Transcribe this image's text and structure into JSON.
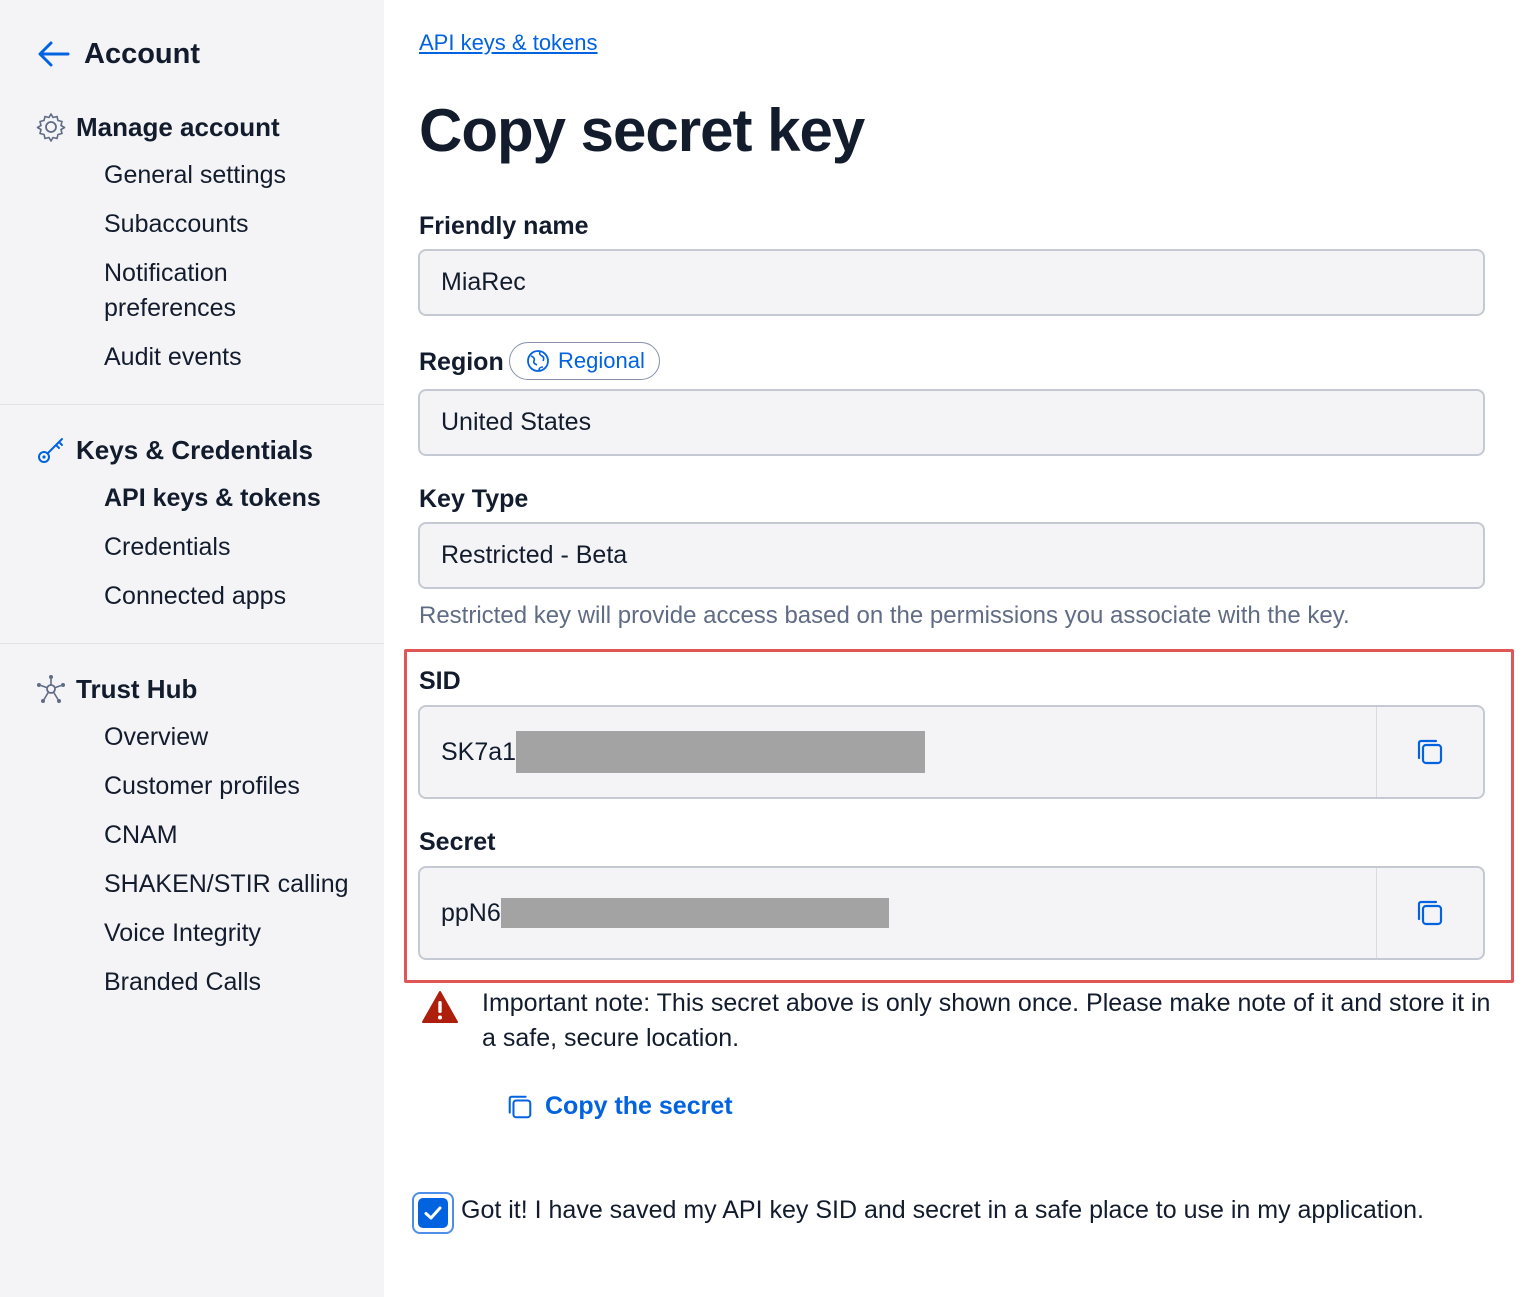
{
  "sidebar": {
    "back_label": "Account",
    "sections": [
      {
        "title": "Manage account",
        "icon": "gear-icon",
        "items": [
          "General settings",
          "Subaccounts",
          "Notification preferences",
          "Audit events"
        ]
      },
      {
        "title": "Keys & Credentials",
        "icon": "key-icon",
        "items": [
          "API keys & tokens",
          "Credentials",
          "Connected apps"
        ]
      },
      {
        "title": "Trust Hub",
        "icon": "trust-hub-icon",
        "items": [
          "Overview",
          "Customer profiles",
          "CNAM",
          "SHAKEN/STIR calling",
          "Voice Integrity",
          "Branded Calls"
        ]
      }
    ],
    "notification_line1": "Notification",
    "notification_line2": "preferences",
    "active_item": "API keys & tokens"
  },
  "main": {
    "breadcrumb": "API keys & tokens",
    "title": "Copy secret key",
    "friendly_name": {
      "label": "Friendly name",
      "value": "MiaRec"
    },
    "region": {
      "label": "Region",
      "badge": "Regional",
      "value": "United States"
    },
    "key_type": {
      "label": "Key Type",
      "value": "Restricted - Beta",
      "help": "Restricted key will provide access based on the permissions you associate with the key."
    },
    "sid": {
      "label": "SID",
      "value_prefix": "SK7a1"
    },
    "secret": {
      "label": "Secret",
      "value_prefix": "ppN6"
    },
    "note": "Important note: This secret above is only shown once. Please make note of it and store it in a safe, secure location.",
    "copy_secret_label": "Copy the secret",
    "confirm": {
      "label": "Got it! I have saved my API key SID and secret in a safe place to use in my application.",
      "checked": true
    }
  },
  "colors": {
    "accent": "#0263e0",
    "highlight": "#e05555",
    "warning": "#ad1e0c",
    "sidebar_bg": "#f4f4f6"
  }
}
